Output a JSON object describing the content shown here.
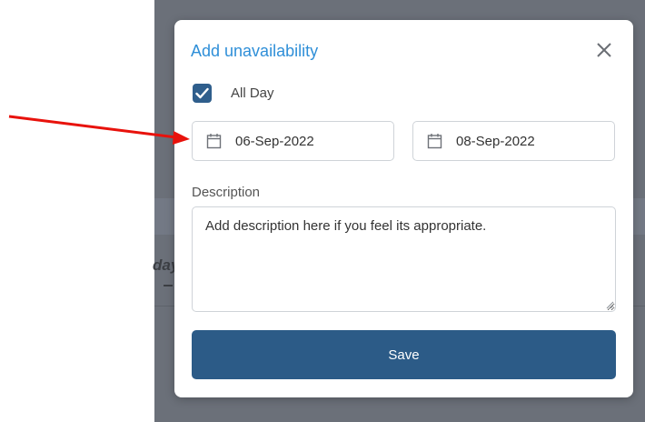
{
  "background": {
    "fragment_text": "day"
  },
  "modal": {
    "title": "Add unavailability",
    "all_day": {
      "label": "All Day",
      "checked": true
    },
    "start_date": "06-Sep-2022",
    "end_date": "08-Sep-2022",
    "description": {
      "label": "Description",
      "value": "Add description here if you feel its appropriate."
    },
    "save_label": "Save"
  },
  "icons": [
    "close-icon",
    "check-icon",
    "calendar-icon",
    "resize-grip-icon",
    "annotation-arrow"
  ],
  "colors": {
    "accent": "#2f8fd8",
    "button": "#2c5b87",
    "checkbox": "#2f5e8c",
    "backdrop": "#6b7079",
    "annotation_arrow": "#e8120c"
  }
}
